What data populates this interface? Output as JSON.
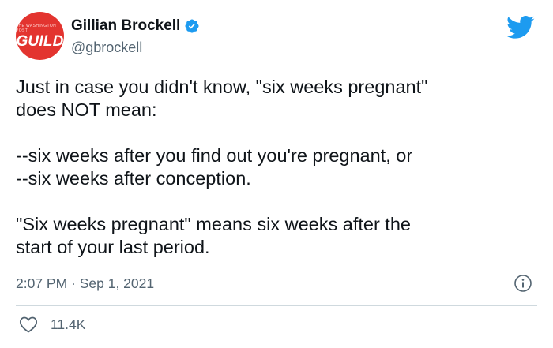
{
  "tweet": {
    "author": {
      "avatar_subtext": "THE WASHINGTON POST",
      "avatar_text": "GUILD",
      "display_name": "Gillian Brockell",
      "handle": "@gbrockell",
      "verified": true
    },
    "text_lines": [
      "Just in case you didn't know, \"six weeks pregnant\"",
      "does NOT mean:",
      "",
      "--six weeks after you find out you're pregnant, or",
      "--six weeks after conception.",
      "",
      "\"Six weeks pregnant\" means six weeks after the",
      "start of your last period."
    ],
    "timestamp": "2:07 PM · Sep 1, 2021",
    "likes": "11.4K"
  },
  "icons": {
    "verified": "verified-badge-icon",
    "brand": "twitter-bird-icon",
    "info": "info-icon",
    "like": "heart-icon"
  },
  "colors": {
    "accent": "#1d9bf0",
    "avatar": "#e3342f",
    "text": "#0f1419",
    "muted": "#536471",
    "divider": "#cfd9de"
  }
}
